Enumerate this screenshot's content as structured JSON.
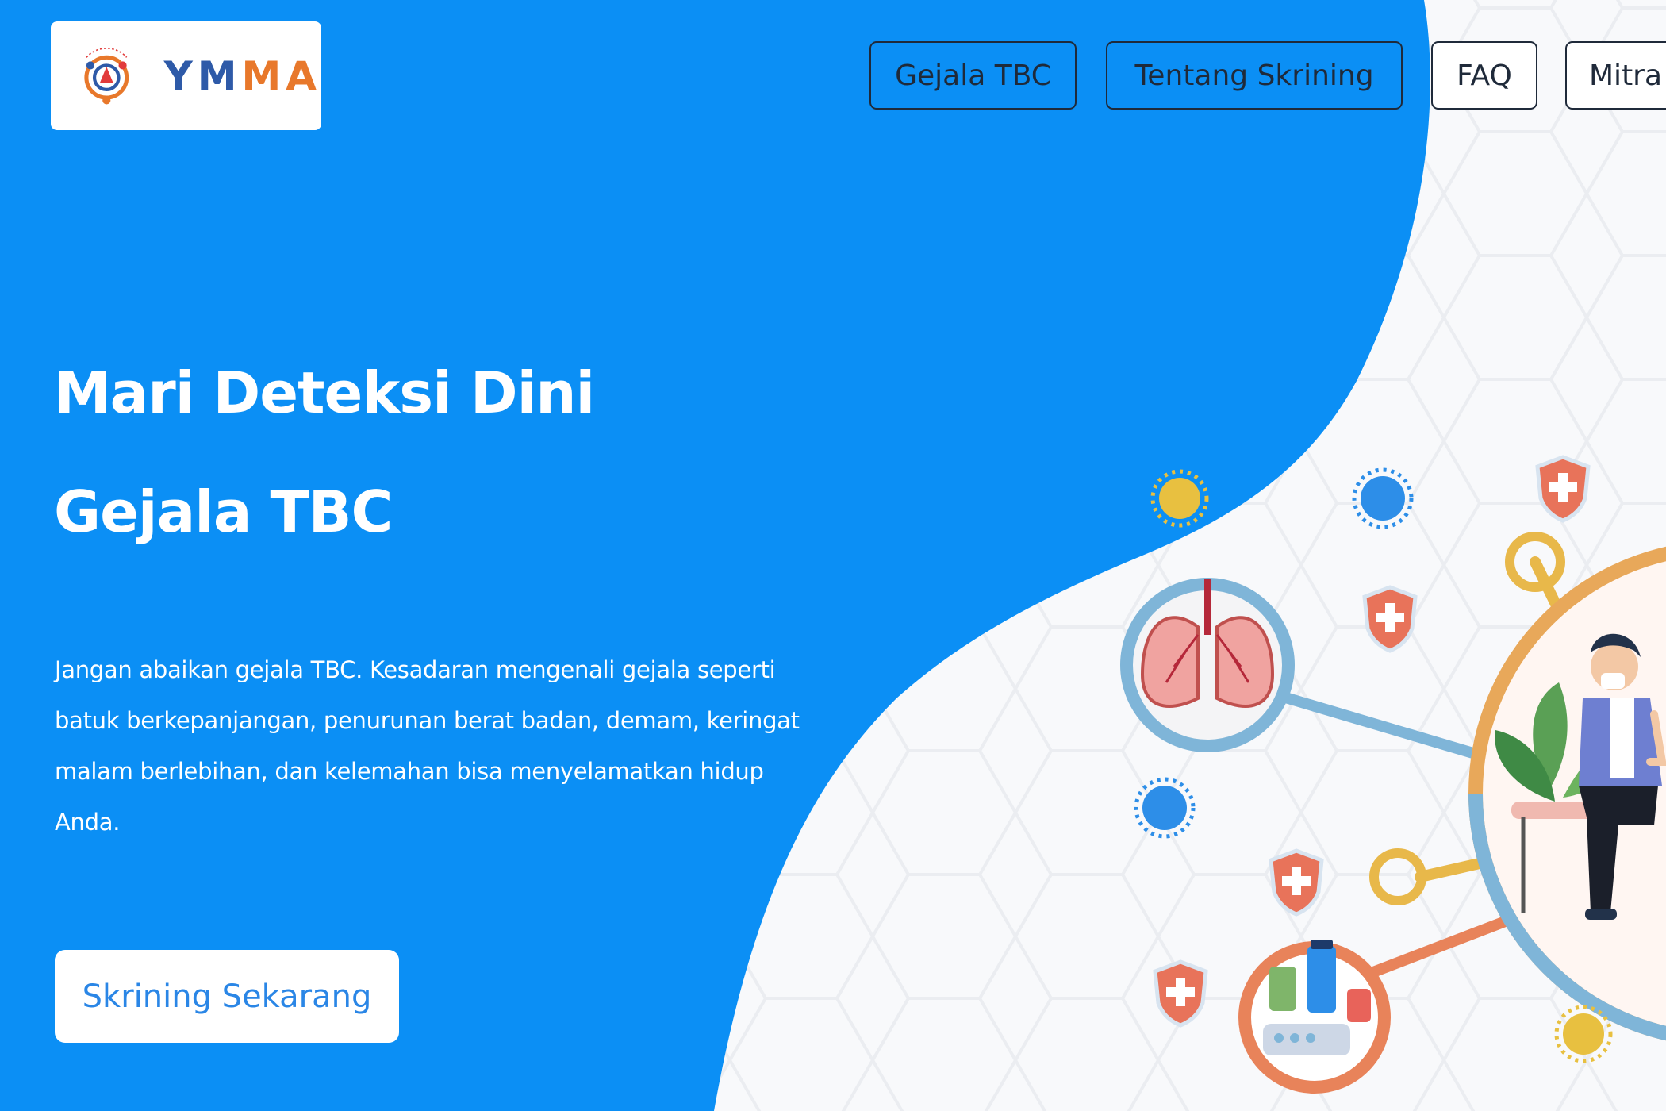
{
  "brand": {
    "name_part1": "YM",
    "name_part2": "MA",
    "logo_icon": "ymma-logo-icon",
    "colors": {
      "primary_blue": "#2e5aa8",
      "orange": "#e8782b"
    }
  },
  "nav": {
    "items": [
      {
        "label": "Gejala TBC"
      },
      {
        "label": "Tentang Skrining"
      },
      {
        "label": "FAQ"
      },
      {
        "label": "Mitra"
      }
    ]
  },
  "hero": {
    "title_line1": "Mari Deteksi Dini",
    "title_line2": "Gejala TBC",
    "description": "Jangan abaikan gejala TBC. Kesadaran mengenali gejala seperti batuk berkepanjangan, penurunan berat badan, demam, keringat malam berlebihan, dan kelemahan bisa menyelamatkan hidup Anda.",
    "cta_label": "Skrining Sekarang"
  },
  "illustration": {
    "icons": [
      "lungs-icon",
      "virus-icon",
      "shield-plus-icon",
      "medicine-icon",
      "patient-illustration",
      "plant-icon"
    ]
  },
  "theme": {
    "hero_blue": "#0b8ff5",
    "cta_text": "#2a86e6",
    "background": "#f7f8fa"
  }
}
